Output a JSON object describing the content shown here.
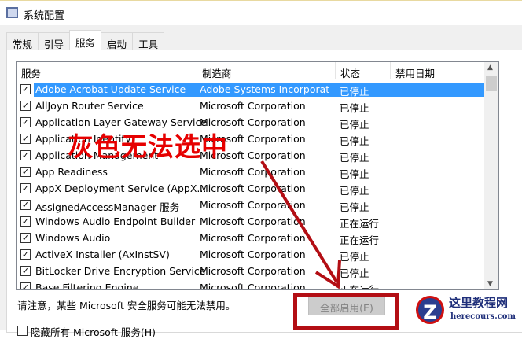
{
  "window": {
    "title": "系统配置"
  },
  "tabs": [
    "常规",
    "引导",
    "服务",
    "启动",
    "工具"
  ],
  "columns": [
    "服务",
    "制造商",
    "状态",
    "禁用日期"
  ],
  "rows": [
    {
      "name": "Adobe Acrobat Update Service",
      "maker": "Adobe Systems Incorporat",
      "status": "已停止",
      "checked": true,
      "selected": true
    },
    {
      "name": "AllJoyn Router Service",
      "maker": "Microsoft Corporation",
      "status": "已停止",
      "checked": true
    },
    {
      "name": "Application Layer Gateway Service",
      "maker": "Microsoft Corporation",
      "status": "已停止",
      "checked": true
    },
    {
      "name": "Application Identity",
      "maker": "Microsoft Corporation",
      "status": "已停止",
      "checked": true
    },
    {
      "name": "Application Management",
      "maker": "Microsoft Corporation",
      "status": "已停止",
      "checked": true
    },
    {
      "name": "App Readiness",
      "maker": "Microsoft Corporation",
      "status": "已停止",
      "checked": true
    },
    {
      "name": "AppX Deployment Service (AppX...",
      "maker": "Microsoft Corporation",
      "status": "已停止",
      "checked": true
    },
    {
      "name": "AssignedAccessManager 服务",
      "maker": "Microsoft Corporation",
      "status": "已停止",
      "checked": true
    },
    {
      "name": "Windows Audio Endpoint Builder",
      "maker": "Microsoft Corporation",
      "status": "正在运行",
      "checked": true
    },
    {
      "name": "Windows Audio",
      "maker": "Microsoft Corporation",
      "status": "正在运行",
      "checked": true
    },
    {
      "name": "ActiveX Installer (AxInstSV)",
      "maker": "Microsoft Corporation",
      "status": "已停止",
      "checked": true
    },
    {
      "name": "BitLocker Drive Encryption Service",
      "maker": "Microsoft Corporation",
      "status": "已停止",
      "checked": true
    },
    {
      "name": "Base Filtering Engine",
      "maker": "Microsoft Corporation",
      "status": "正在运行",
      "checked": true
    }
  ],
  "note": "请注意，某些 Microsoft 安全服务可能无法禁用。",
  "enable_all_button": "全部启用(E)",
  "hide_ms_label": "隐藏所有 Microsoft 服务(H)",
  "annotation": "灰色无法选中",
  "watermark": {
    "title": "这里教程网",
    "url": "herecours.com",
    "logo": "Z"
  }
}
